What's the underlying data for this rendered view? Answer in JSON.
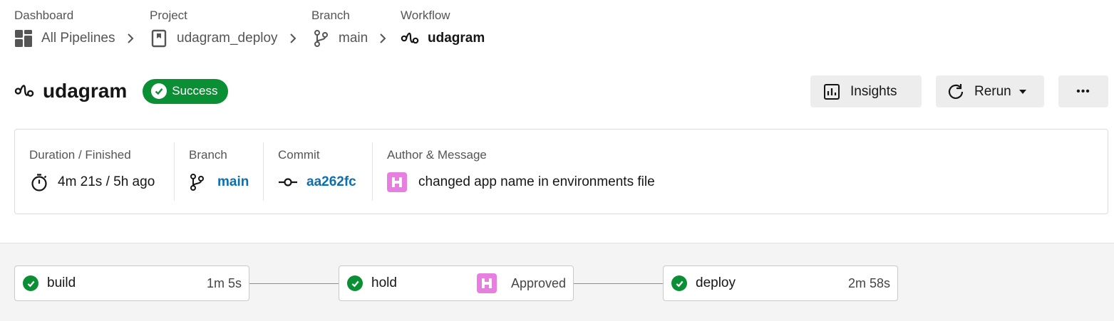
{
  "breadcrumb": {
    "items": [
      {
        "label": "Dashboard",
        "value": "All Pipelines",
        "icon": "dashboard-icon"
      },
      {
        "label": "Project",
        "value": "udagram_deploy",
        "icon": "bookmark-icon"
      },
      {
        "label": "Branch",
        "value": "main",
        "icon": "branch-icon"
      },
      {
        "label": "Workflow",
        "value": "udagram",
        "icon": "workflow-icon"
      }
    ]
  },
  "header": {
    "title": "udagram",
    "status": "Success",
    "status_color": "#0b8f35",
    "insights_label": "Insights",
    "rerun_label": "Rerun",
    "more_label": "•••"
  },
  "details": {
    "duration_label": "Duration / Finished",
    "duration_value": "4m 21s / 5h ago",
    "branch_label": "Branch",
    "branch_value": "main",
    "commit_label": "Commit",
    "commit_value": "aa262fc",
    "author_label": "Author & Message",
    "message": "changed app name in environments file",
    "link_color": "#0b6fb0"
  },
  "jobs": [
    {
      "name": "build",
      "meta": "1m 5s",
      "status": "success"
    },
    {
      "name": "hold",
      "meta": "Approved",
      "status": "success"
    },
    {
      "name": "deploy",
      "meta": "2m 58s",
      "status": "success"
    }
  ]
}
